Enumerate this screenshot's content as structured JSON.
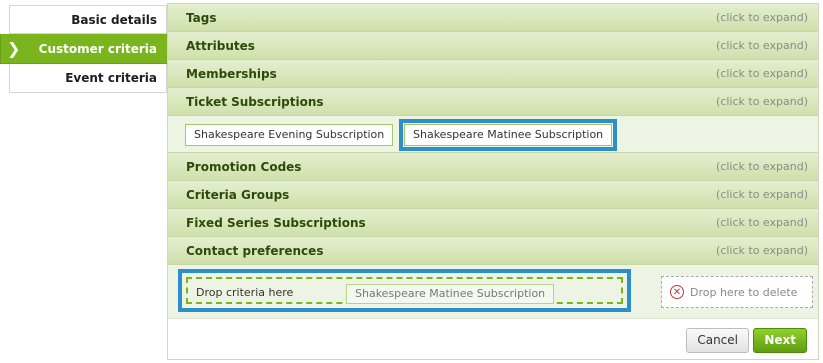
{
  "nav": {
    "items": [
      {
        "label": "Basic details",
        "active": false
      },
      {
        "label": "Customer criteria",
        "active": true
      },
      {
        "label": "Event criteria",
        "active": false
      }
    ]
  },
  "sections": [
    {
      "title": "Tags",
      "hint": "(click to expand)"
    },
    {
      "title": "Attributes",
      "hint": "(click to expand)"
    },
    {
      "title": "Memberships",
      "hint": "(click to expand)"
    },
    {
      "title": "Ticket Subscriptions",
      "hint": "(click to expand)"
    },
    {
      "title": "Promotion Codes",
      "hint": "(click to expand)"
    },
    {
      "title": "Criteria Groups",
      "hint": "(click to expand)"
    },
    {
      "title": "Fixed Series Subscriptions",
      "hint": "(click to expand)"
    },
    {
      "title": "Contact preferences",
      "hint": "(click to expand)"
    }
  ],
  "ticket_subscriptions": {
    "options": [
      "Shakespeare Evening Subscription",
      "Shakespeare Matinee Subscription"
    ]
  },
  "drop": {
    "label": "Drop criteria here",
    "dragged_item": "Shakespeare Matinee Subscription",
    "delete_label": "Drop here to delete"
  },
  "footer": {
    "cancel_label": "Cancel",
    "next_label": "Next"
  },
  "colors": {
    "accent_green": "#7ab51d",
    "highlight_blue": "#2d8fc9"
  }
}
